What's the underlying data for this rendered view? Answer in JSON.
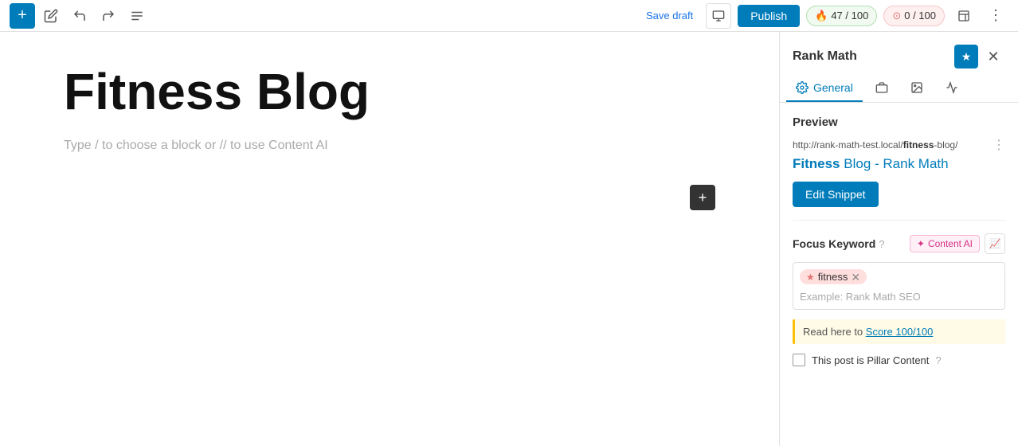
{
  "toolbar": {
    "add_label": "+",
    "save_draft_label": "Save draft",
    "publish_label": "Publish",
    "score_green": "47 / 100",
    "score_red": "0 / 100"
  },
  "editor": {
    "title": "Fitness Blog",
    "placeholder": "Type / to choose a block or // to use Content AI"
  },
  "sidebar": {
    "title": "Rank Math",
    "tabs": [
      {
        "label": "General",
        "active": true
      },
      {
        "label": "Briefcase"
      },
      {
        "label": "Image"
      },
      {
        "label": "Analytics"
      }
    ],
    "preview": {
      "section_title": "Preview",
      "url_prefix": "http://rank-math-test.local/",
      "url_bold": "fitness",
      "url_suffix": "-blog/",
      "link_normal": " Blog - Rank Math",
      "link_bold": "Fitness",
      "edit_snippet_label": "Edit Snippet"
    },
    "focus_keyword": {
      "title": "Focus Keyword",
      "keyword": "fitness",
      "content_ai_label": "Content AI",
      "placeholder": "Example: Rank Math SEO"
    },
    "read_here": {
      "prefix": "Read here to ",
      "link_label": "Score 100/100"
    },
    "pillar": {
      "label": "This post is Pillar Content"
    }
  }
}
